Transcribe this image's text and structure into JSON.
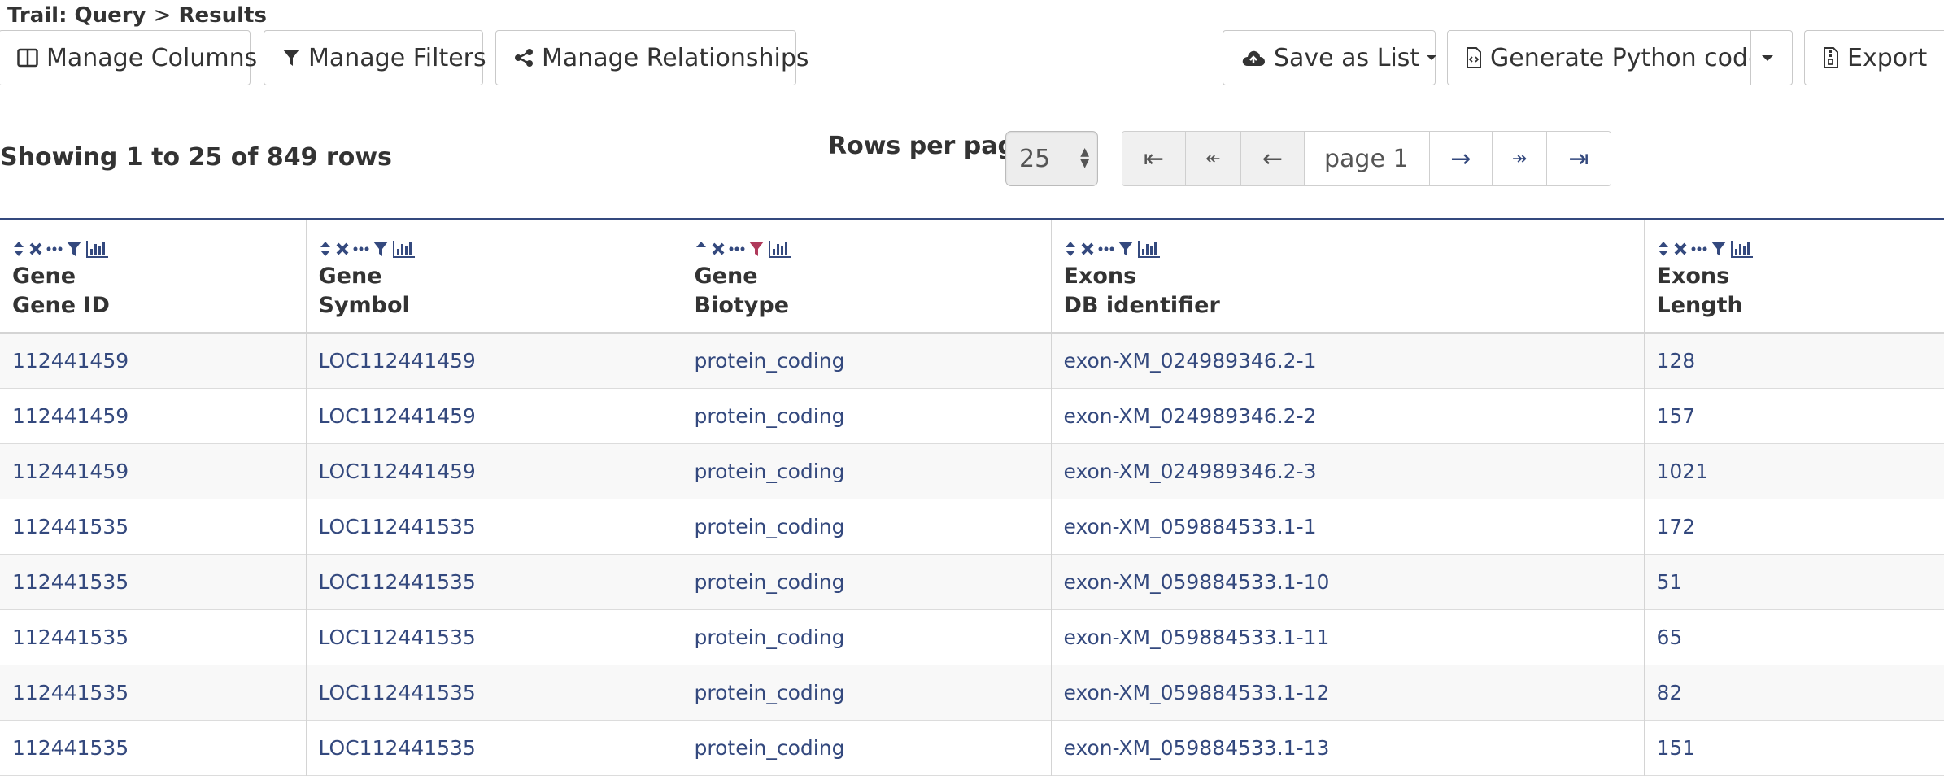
{
  "breadcrumb": {
    "trail": "Trail:",
    "query": "Query",
    "sep": ">",
    "results": "Results"
  },
  "toolbar": {
    "manage_columns": "Manage Columns",
    "manage_filters": "Manage Filters",
    "manage_relationships": "Manage Relationships",
    "save_as_list": "Save as List",
    "generate_python": "Generate Python code",
    "export": "Export"
  },
  "summary": {
    "showing": "Showing 1 to 25 of 849 rows"
  },
  "pagination": {
    "rows_per_page_label": "Rows per page:",
    "rows_per_page_value": "25",
    "first": "⇤",
    "prev_many": "↞",
    "prev": "←",
    "page_value": "page 1",
    "next": "→",
    "next_many": "↠",
    "last": "⇥"
  },
  "colors": {
    "accent": "#34497e",
    "active_filter": "#b03a5b"
  },
  "table": {
    "columns": [
      {
        "line1": "Gene",
        "line2": "Gene ID",
        "sort": "both",
        "filter_active": false
      },
      {
        "line1": "Gene",
        "line2": "Symbol",
        "sort": "both",
        "filter_active": false
      },
      {
        "line1": "Gene",
        "line2": "Biotype",
        "sort": "up",
        "filter_active": true
      },
      {
        "line1": "Exons",
        "line2": "DB identifier",
        "sort": "both",
        "filter_active": false
      },
      {
        "line1": "Exons",
        "line2": "Length",
        "sort": "both",
        "filter_active": false
      }
    ],
    "rows": [
      [
        "112441459",
        "LOC112441459",
        "protein_coding",
        "exon-XM_024989346.2-1",
        "128"
      ],
      [
        "112441459",
        "LOC112441459",
        "protein_coding",
        "exon-XM_024989346.2-2",
        "157"
      ],
      [
        "112441459",
        "LOC112441459",
        "protein_coding",
        "exon-XM_024989346.2-3",
        "1021"
      ],
      [
        "112441535",
        "LOC112441535",
        "protein_coding",
        "exon-XM_059884533.1-1",
        "172"
      ],
      [
        "112441535",
        "LOC112441535",
        "protein_coding",
        "exon-XM_059884533.1-10",
        "51"
      ],
      [
        "112441535",
        "LOC112441535",
        "protein_coding",
        "exon-XM_059884533.1-11",
        "65"
      ],
      [
        "112441535",
        "LOC112441535",
        "protein_coding",
        "exon-XM_059884533.1-12",
        "82"
      ],
      [
        "112441535",
        "LOC112441535",
        "protein_coding",
        "exon-XM_059884533.1-13",
        "151"
      ]
    ]
  }
}
